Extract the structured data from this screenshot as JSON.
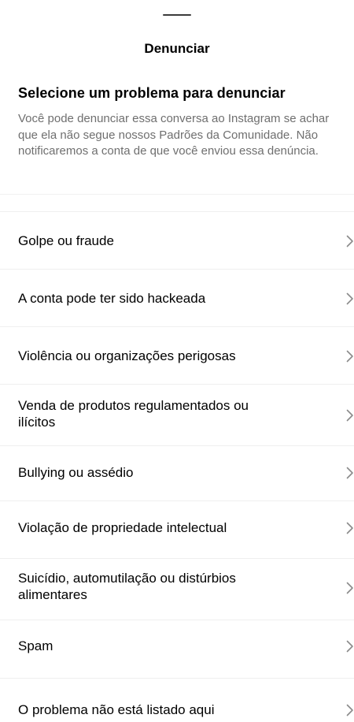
{
  "sheet": {
    "title": "Denunciar",
    "heading": "Selecione um problema para denunciar",
    "description": "Você pode denunciar essa conversa ao Instagram se achar que ela não segue nossos Padrões da Comunidade. Não notificaremos a conta de que você enviou essa denúncia."
  },
  "options": [
    {
      "label": "Golpe ou fraude",
      "icon": "chevron-right-icon"
    },
    {
      "label": "A conta pode ter sido hackeada",
      "icon": "chevron-right-icon"
    },
    {
      "label": "Violência ou organizações perigosas",
      "icon": "chevron-right-icon"
    },
    {
      "label": "Venda de produtos regulamentados ou ilícitos",
      "icon": "chevron-right-icon"
    },
    {
      "label": "Bullying ou assédio",
      "icon": "chevron-right-icon"
    },
    {
      "label": "Violação de propriedade intelectual",
      "icon": "chevron-right-icon"
    },
    {
      "label": "Suicídio, automutilação ou distúrbios alimentares",
      "icon": "chevron-right-icon"
    },
    {
      "label": "Spam",
      "icon": "chevron-right-icon"
    },
    {
      "label": "O problema não está listado aqui",
      "icon": "chevron-right-icon"
    }
  ],
  "colors": {
    "text": "#000000",
    "secondary_text": "#6f6f6f",
    "divider": "#efefef",
    "chevron": "#8a8a8a"
  }
}
